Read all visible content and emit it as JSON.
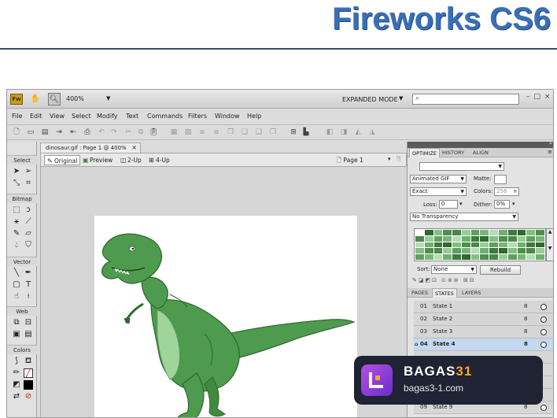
{
  "banner": {
    "title": "Fireworks CS6"
  },
  "appbar": {
    "logo": "Fw",
    "zoom": "400%",
    "workspace_mode": "EXPANDED MODE",
    "search_placeholder": ""
  },
  "menu": [
    "File",
    "Edit",
    "View",
    "Select",
    "Modify",
    "Text",
    "Commands",
    "Filters",
    "Window",
    "Help"
  ],
  "tools": {
    "sections": [
      "Select",
      "Bitmap",
      "Vector",
      "Web",
      "Colors"
    ]
  },
  "document": {
    "tab_label": "dinosaur.gif : Page 1 @ 400%",
    "views": [
      "Original",
      "Preview",
      "2-Up",
      "4-Up"
    ],
    "page": "Page 1"
  },
  "optimize": {
    "tabs": [
      "OPTIMIZE",
      "HISTORY",
      "ALIGN"
    ],
    "format": "Animated GIF",
    "matte_label": "Matte:",
    "palette": "Exact",
    "colors_label": "Colors:",
    "colors_value": "256",
    "loss_label": "Loss:",
    "loss_value": "0",
    "dither_label": "Dither:",
    "dither_value": "0%",
    "transparency": "No Transparency",
    "sort_label": "Sort:",
    "sort_value": "None",
    "rebuild_label": "Rebuild"
  },
  "states_panel": {
    "tabs": [
      "PAGES",
      "STATES",
      "LAYERS"
    ],
    "rows": [
      {
        "num": "01",
        "name": "State 1",
        "delay": "8",
        "selected": false
      },
      {
        "num": "02",
        "name": "State 2",
        "delay": "8",
        "selected": false
      },
      {
        "num": "03",
        "name": "State 3",
        "delay": "8",
        "selected": false
      },
      {
        "num": "04",
        "name": "State 4",
        "delay": "8",
        "selected": true
      },
      {
        "num": "09",
        "name": "State 9",
        "delay": "8",
        "selected": false
      }
    ]
  },
  "watermark": {
    "title_a": "BAGAS",
    "title_b": "31",
    "subtitle": "bagas3-1.com"
  },
  "colors": {
    "banner": "#3a6fb6",
    "dino_green": "#4e9a4e",
    "dino_belly": "#9fd49a",
    "watermark_bg": "#1f2333",
    "watermark_accent": "#f5a623"
  }
}
